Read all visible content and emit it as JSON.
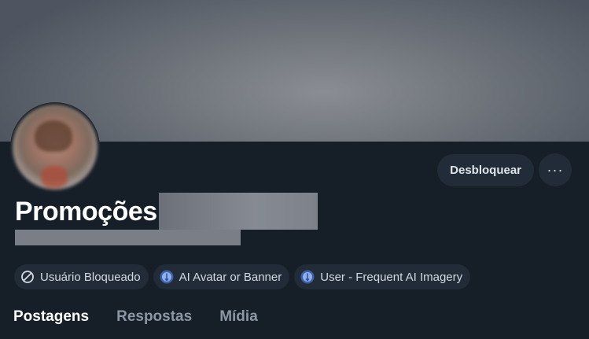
{
  "profile": {
    "display_name": "Promoções"
  },
  "actions": {
    "unblock_label": "Desbloquear",
    "more_label": "···"
  },
  "labels": [
    {
      "text": "Usuário Bloqueado",
      "icon": "blocked-icon"
    },
    {
      "text": "AI Avatar or Banner",
      "icon": "labeler-avatar-icon"
    },
    {
      "text": "User - Frequent AI Imagery",
      "icon": "labeler-avatar-icon"
    }
  ],
  "tabs": [
    {
      "label": "Postagens",
      "active": true
    },
    {
      "label": "Respostas",
      "active": false
    },
    {
      "label": "Mídia",
      "active": false
    }
  ],
  "colors": {
    "background": "#161e27",
    "pill": "#222c38",
    "tab_inactive": "#8b97a4",
    "labeler_icon": "#4d7bd6"
  }
}
